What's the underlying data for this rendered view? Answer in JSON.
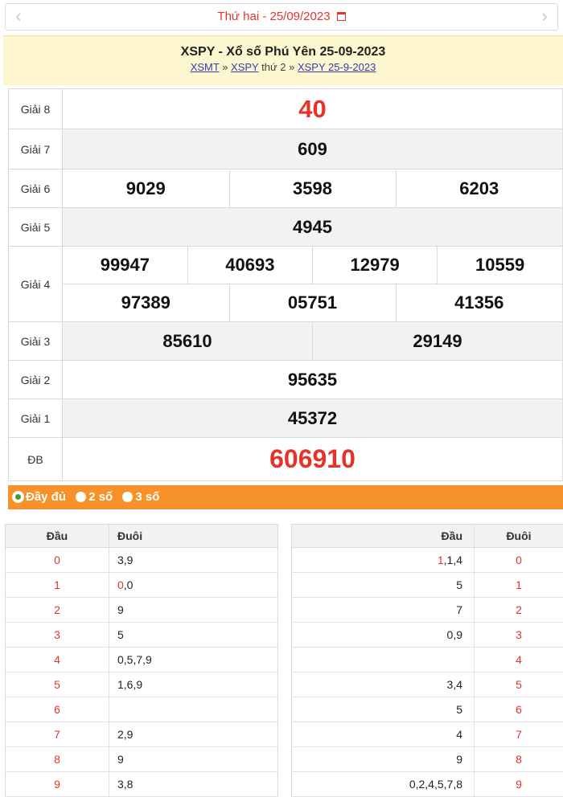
{
  "nav": {
    "prev_icon": "chevron-left-icon",
    "next_icon": "chevron-right-icon",
    "date_text": "Thứ hai -  25/09/2023",
    "calendar_icon": "calendar-icon"
  },
  "header": {
    "title": "XSPY - Xổ số Phú Yên 25-09-2023",
    "crumb1": "XSMT",
    "sep": " » ",
    "crumb2": "XSPY",
    "crumb2_suffix": " thứ 2",
    "crumb3": "XSPY 25-9-2023"
  },
  "prizes": {
    "g8": {
      "label": "Giải 8",
      "values": [
        "40"
      ]
    },
    "g7": {
      "label": "Giải 7",
      "values": [
        "609"
      ]
    },
    "g6": {
      "label": "Giải 6",
      "values": [
        "9029",
        "3598",
        "6203"
      ]
    },
    "g5": {
      "label": "Giải 5",
      "values": [
        "4945"
      ]
    },
    "g4": {
      "label": "Giải 4",
      "values": [
        "99947",
        "40693",
        "12979",
        "10559",
        "97389",
        "05751",
        "41356"
      ]
    },
    "g3": {
      "label": "Giải 3",
      "values": [
        "85610",
        "29149"
      ]
    },
    "g2": {
      "label": "Giải 2",
      "values": [
        "95635"
      ]
    },
    "g1": {
      "label": "Giải 1",
      "values": [
        "45372"
      ]
    },
    "db": {
      "label": "ĐB",
      "values": [
        "606910"
      ]
    }
  },
  "options": {
    "full": "Đầy đủ",
    "two": "2 số",
    "three": "3 số"
  },
  "dau_table": {
    "col_dau": "Đầu",
    "col_duoi": "Đuôi",
    "rows": [
      {
        "dau": "0",
        "duoi_hl": "",
        "duoi": "3,9"
      },
      {
        "dau": "1",
        "duoi_hl": "0",
        "duoi": ",0"
      },
      {
        "dau": "2",
        "duoi_hl": "",
        "duoi": "9"
      },
      {
        "dau": "3",
        "duoi_hl": "",
        "duoi": "5"
      },
      {
        "dau": "4",
        "duoi_hl": "",
        "duoi": "0,5,7,9"
      },
      {
        "dau": "5",
        "duoi_hl": "",
        "duoi": "1,6,9"
      },
      {
        "dau": "6",
        "duoi_hl": "",
        "duoi": ""
      },
      {
        "dau": "7",
        "duoi_hl": "",
        "duoi": "2,9"
      },
      {
        "dau": "8",
        "duoi_hl": "",
        "duoi": "9"
      },
      {
        "dau": "9",
        "duoi_hl": "",
        "duoi": "3,8"
      }
    ]
  },
  "duoi_table": {
    "col_dau": "Đầu",
    "col_duoi": "Đuôi",
    "rows": [
      {
        "dau_hl": "1",
        "dau": ",1,4",
        "duoi": "0"
      },
      {
        "dau_hl": "",
        "dau": "5",
        "duoi": "1"
      },
      {
        "dau_hl": "",
        "dau": "7",
        "duoi": "2"
      },
      {
        "dau_hl": "",
        "dau": "0,9",
        "duoi": "3"
      },
      {
        "dau_hl": "",
        "dau": "",
        "duoi": "4"
      },
      {
        "dau_hl": "",
        "dau": "3,4",
        "duoi": "5"
      },
      {
        "dau_hl": "",
        "dau": "5",
        "duoi": "6"
      },
      {
        "dau_hl": "",
        "dau": "4",
        "duoi": "7"
      },
      {
        "dau_hl": "",
        "dau": "9",
        "duoi": "8"
      },
      {
        "dau_hl": "",
        "dau": "0,2,4,5,7,8",
        "duoi": "9"
      }
    ]
  },
  "colors": {
    "red": "#e5332a",
    "orange": "#f7922a",
    "title_bg": "#fdf6cf"
  }
}
